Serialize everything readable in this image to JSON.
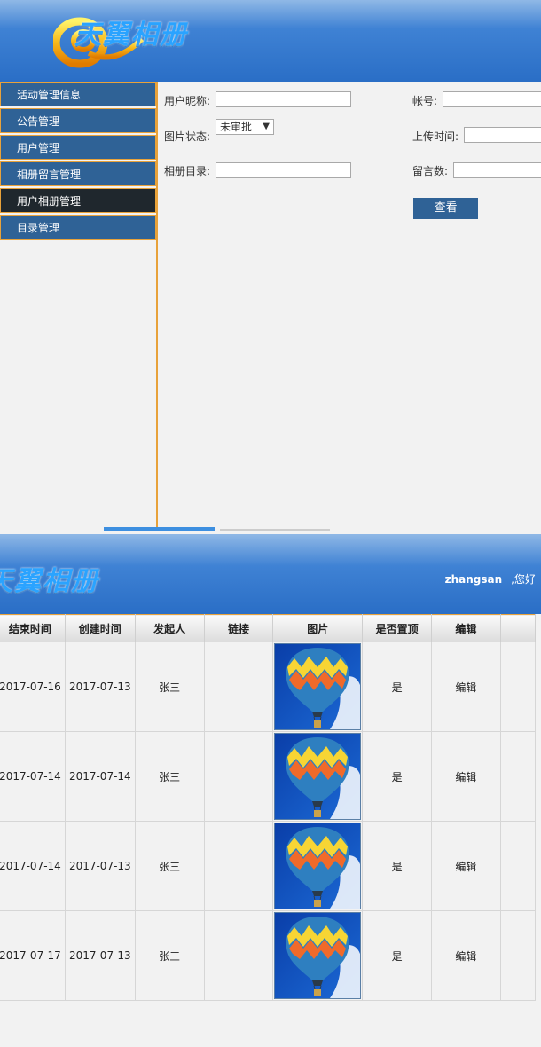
{
  "app": {
    "logo_text": "天翼相册"
  },
  "sidebar": {
    "items": [
      {
        "label": "活动管理信息",
        "active": false
      },
      {
        "label": "公告管理",
        "active": false
      },
      {
        "label": "用户管理",
        "active": false
      },
      {
        "label": "相册留言管理",
        "active": false
      },
      {
        "label": "用户相册管理",
        "active": true
      },
      {
        "label": "目录管理",
        "active": false
      }
    ]
  },
  "form": {
    "nickname_label": "用户昵称:",
    "nickname_value": "",
    "account_label": "帐号:",
    "account_value": "",
    "status_label": "图片状态:",
    "status_selected": "未审批",
    "upload_time_label": "上传时间:",
    "upload_time_value": "",
    "album_dir_label": "相册目录:",
    "album_dir_value": "",
    "comments_label": "留言数:",
    "comments_value": "",
    "view_button": "查看"
  },
  "header2": {
    "username": "zhangsan",
    "greeting": ",您好"
  },
  "table": {
    "columns": [
      "结束时间",
      "创建时间",
      "发起人",
      "链接",
      "图片",
      "是否置顶",
      "编辑"
    ],
    "rows": [
      {
        "end": "2017-07-16",
        "created": "2017-07-13",
        "owner": "张三",
        "link": "",
        "image": "balloon-image",
        "pinned": "是",
        "edit": "编辑"
      },
      {
        "end": "2017-07-14",
        "created": "2017-07-14",
        "owner": "张三",
        "link": "",
        "image": "balloon-image",
        "pinned": "是",
        "edit": "编辑"
      },
      {
        "end": "2017-07-14",
        "created": "2017-07-13",
        "owner": "张三",
        "link": "",
        "image": "balloon-image",
        "pinned": "是",
        "edit": "编辑"
      },
      {
        "end": "2017-07-17",
        "created": "2017-07-13",
        "owner": "张三",
        "link": "",
        "image": "balloon-image",
        "pinned": "是",
        "edit": "编辑"
      }
    ]
  },
  "colors": {
    "header_blue": "#2a6ec6",
    "sidebar_blue": "#2f6296",
    "sidebar_active": "#1f272d",
    "accent_orange": "#e8a23a"
  }
}
